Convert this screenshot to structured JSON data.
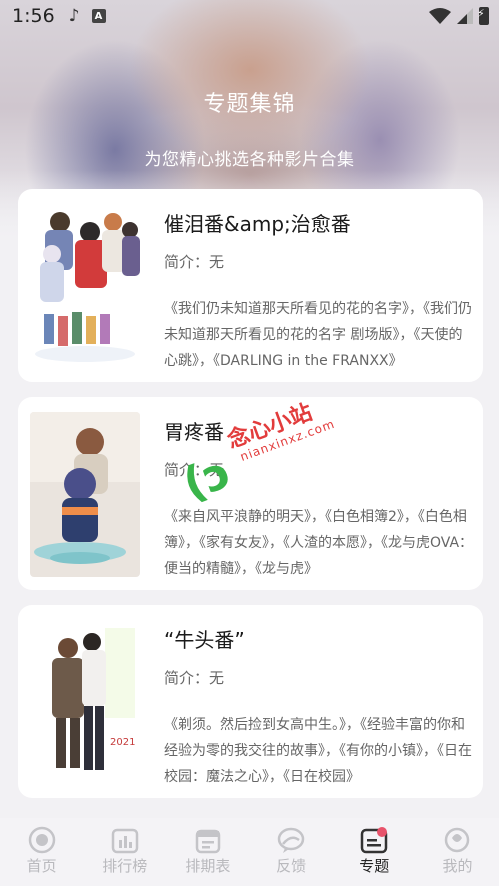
{
  "status_bar": {
    "time": "1:56",
    "music_icon": "music-note-icon",
    "a_icon": "A"
  },
  "header": {
    "title": "专题集锦",
    "subtitle": "为您精心挑选各种影片合集"
  },
  "collections": [
    {
      "title": "催泪番&amp;治愈番",
      "intro": "简介：无",
      "titles": "《我们仍未知道那天所看见的花的名字》，《我们仍未知道那天所看见的花的名字 剧场版》，《天使的心跳》，《DARLING in the FRANXX》"
    },
    {
      "title": "胃疼番",
      "intro": "简介：无",
      "titles": "《来自风平浪静的明天》，《白色相簿2》，《白色相簿》，《家有女友》，《人渣的本愿》，《龙与虎OVA：便当的精髓》，《龙与虎》"
    },
    {
      "title": "“牛头番”",
      "intro": "简介：无",
      "titles": "《剃须。然后捡到女高中生。》，《经验丰富的你和经验为零的我交往的故事》，《有你的小镇》，《日在校园：魔法之心》，《日在校园》"
    }
  ],
  "watermark": {
    "text": "念心小站",
    "url": "nianxinxz.com"
  },
  "nav": [
    {
      "label": "首页",
      "icon": "home-icon",
      "active": false
    },
    {
      "label": "排行榜",
      "icon": "ranking-icon",
      "active": false
    },
    {
      "label": "排期表",
      "icon": "calendar-icon",
      "active": false
    },
    {
      "label": "反馈",
      "icon": "feedback-icon",
      "active": false
    },
    {
      "label": "专题",
      "icon": "topics-icon",
      "active": true
    },
    {
      "label": "我的",
      "icon": "profile-icon",
      "active": false
    }
  ],
  "colors": {
    "accent": "#e8536b",
    "nav_inactive": "#b9b9bd",
    "nav_active": "#222222"
  }
}
